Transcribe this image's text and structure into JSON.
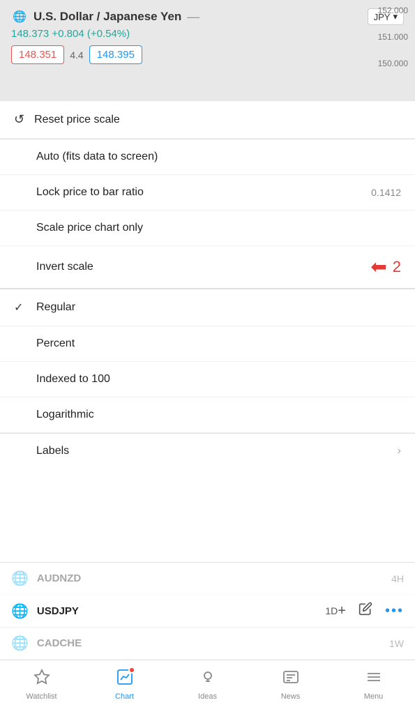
{
  "header": {
    "flag": "🌐",
    "title": "U.S. Dollar / Japanese Yen",
    "currency": "JPY",
    "price_main": "148.373  +0.804  (+0.54%)",
    "price_left": "148.351",
    "price_mid": "4.4",
    "price_right": "148.395",
    "scale_labels": [
      "152.000",
      "151.000",
      "150.000"
    ]
  },
  "menu": {
    "reset_label": "Reset price scale",
    "auto_label": "Auto (fits data to screen)",
    "lock_label": "Lock price to bar ratio",
    "lock_value": "0.1412",
    "scale_price_label": "Scale price chart only",
    "invert_label": "Invert scale",
    "invert_annotation": "2",
    "regular_label": "Regular",
    "percent_label": "Percent",
    "indexed_label": "Indexed to 100",
    "logarithmic_label": "Logarithmic",
    "labels_label": "Labels"
  },
  "ticker": {
    "flag": "🌐",
    "symbol": "USDJPY",
    "timeframe": "1D",
    "add_label": "+",
    "edit_label": "✏",
    "more_label": "•••",
    "below_symbol": "CADCHE",
    "below_timeframe": "1W"
  },
  "bottom_nav": {
    "watchlist_label": "Watchlist",
    "chart_label": "Chart",
    "ideas_label": "Ideas",
    "news_label": "News",
    "menu_label": "Menu"
  }
}
